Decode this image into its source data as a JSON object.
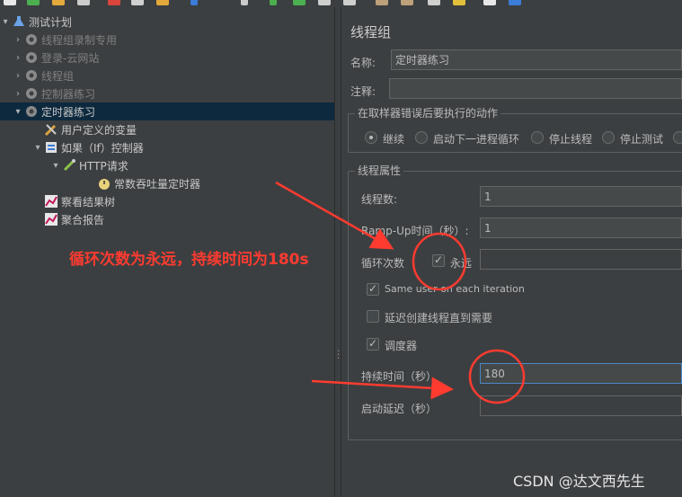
{
  "tree": {
    "items": [
      {
        "label": "测试计划",
        "icon": "flask-icon",
        "name": "tree-item-test-plan",
        "arrow": "▾",
        "selected": false,
        "dim": false
      },
      {
        "label": "线程组录制专用",
        "icon": "gear-icon",
        "name": "tree-item-thread-group-recording",
        "arrow": "›",
        "selected": false,
        "dim": true
      },
      {
        "label": "登录-云网站",
        "icon": "gear-icon",
        "name": "tree-item-login-cloud",
        "arrow": "›",
        "selected": false,
        "dim": true
      },
      {
        "label": "线程组",
        "icon": "gear-icon",
        "name": "tree-item-thread-group",
        "arrow": "›",
        "selected": false,
        "dim": true
      },
      {
        "label": "控制器练习",
        "icon": "gear-icon",
        "name": "tree-item-controller-practice",
        "arrow": "›",
        "selected": false,
        "dim": true
      },
      {
        "label": "定时器练习",
        "icon": "gear-icon",
        "name": "tree-item-timer-practice",
        "arrow": "▾",
        "selected": true,
        "dim": false
      },
      {
        "label": "用户定义的变量",
        "icon": "wrench-icon",
        "name": "tree-item-user-variables",
        "arrow": "",
        "selected": false,
        "dim": false
      },
      {
        "label": "如果（If）控制器",
        "icon": "controller-icon",
        "name": "tree-item-if-controller",
        "arrow": "▾",
        "selected": false,
        "dim": false
      },
      {
        "label": "HTTP请求",
        "icon": "pipette-icon",
        "name": "tree-item-http-request",
        "arrow": "▾",
        "selected": false,
        "dim": false
      },
      {
        "label": "常数吞吐量定时器",
        "icon": "timer-icon",
        "name": "tree-item-constant-throughput-timer",
        "arrow": "",
        "selected": false,
        "dim": false
      },
      {
        "label": "察看结果树",
        "icon": "chart-icon",
        "name": "tree-item-view-results-tree",
        "arrow": "",
        "selected": false,
        "dim": false
      },
      {
        "label": "聚合报告",
        "icon": "chart-icon",
        "name": "tree-item-aggregate-report",
        "arrow": "",
        "selected": false,
        "dim": false
      }
    ]
  },
  "panel": {
    "title": "线程组",
    "name_label": "名称:",
    "name_value": "定时器练习",
    "comment_label": "注释:",
    "comment_value": "",
    "error_group_title": "在取样器错误后要执行的动作",
    "error_actions": [
      {
        "label": "继续",
        "selected": true
      },
      {
        "label": "启动下一进程循环",
        "selected": false
      },
      {
        "label": "停止线程",
        "selected": false
      },
      {
        "label": "停止测试",
        "selected": false
      }
    ],
    "thread_props_title": "线程属性",
    "threads_label": "线程数:",
    "threads_value": "1",
    "rampup_label": "Ramp-Up时间（秒）:",
    "rampup_value": "1",
    "loop_label": "循环次数",
    "forever_label": "永远",
    "forever_checked": true,
    "loop_value": "",
    "same_user_label": "Same user on each iteration",
    "same_user_checked": true,
    "delay_create_label": "延迟创建线程直到需要",
    "delay_create_checked": false,
    "scheduler_label": "调度器",
    "scheduler_checked": true,
    "duration_label": "持续时间（秒）",
    "duration_value": "180",
    "startup_delay_label": "启动延迟（秒）",
    "startup_delay_value": ""
  },
  "annotation": "循环次数为永远，持续时间为180s",
  "watermark": "CSDN @达文西先生",
  "colors": {
    "background": "#3c3f41",
    "selection": "#0d293e",
    "annotation": "#ff3b30",
    "focus": "#4a88c7"
  }
}
